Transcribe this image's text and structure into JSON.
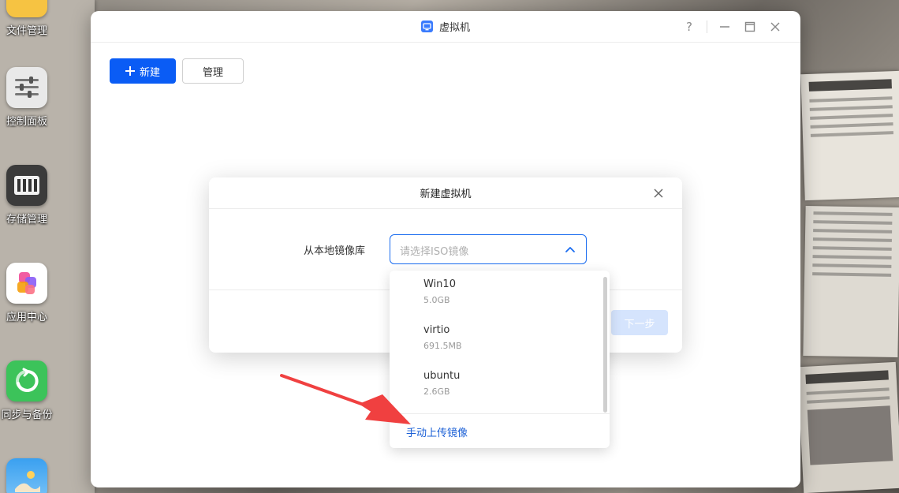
{
  "desktop": {
    "icons": [
      {
        "label": "文件管理",
        "icon": "folder-icon"
      },
      {
        "label": "控制面板",
        "icon": "sliders-icon"
      },
      {
        "label": "存储管理",
        "icon": "storage-icon"
      },
      {
        "label": "应用中心",
        "icon": "apps-icon"
      },
      {
        "label": "同步与备份",
        "icon": "sync-icon"
      },
      {
        "label": "",
        "icon": "photos-icon"
      }
    ]
  },
  "window": {
    "title": "虚拟机",
    "controls": {
      "help": "?",
      "minimize": "—",
      "maximize": "☐",
      "close": "✕"
    },
    "toolbar": {
      "new_label": "新建",
      "manage_label": "管理"
    }
  },
  "dialog": {
    "title": "新建虚拟机",
    "field_label": "从本地镜像库",
    "select_placeholder": "请选择ISO镜像",
    "next_label": "下一步"
  },
  "dropdown": {
    "items": [
      {
        "name": "Win10",
        "size": "5.0GB"
      },
      {
        "name": "virtio",
        "size": "691.5MB"
      },
      {
        "name": "ubuntu",
        "size": "2.6GB"
      }
    ],
    "upload_label": "手动上传镜像"
  },
  "colors": {
    "primary": "#0a5cf5",
    "link": "#1a5fd6",
    "arrow": "#f04040"
  }
}
